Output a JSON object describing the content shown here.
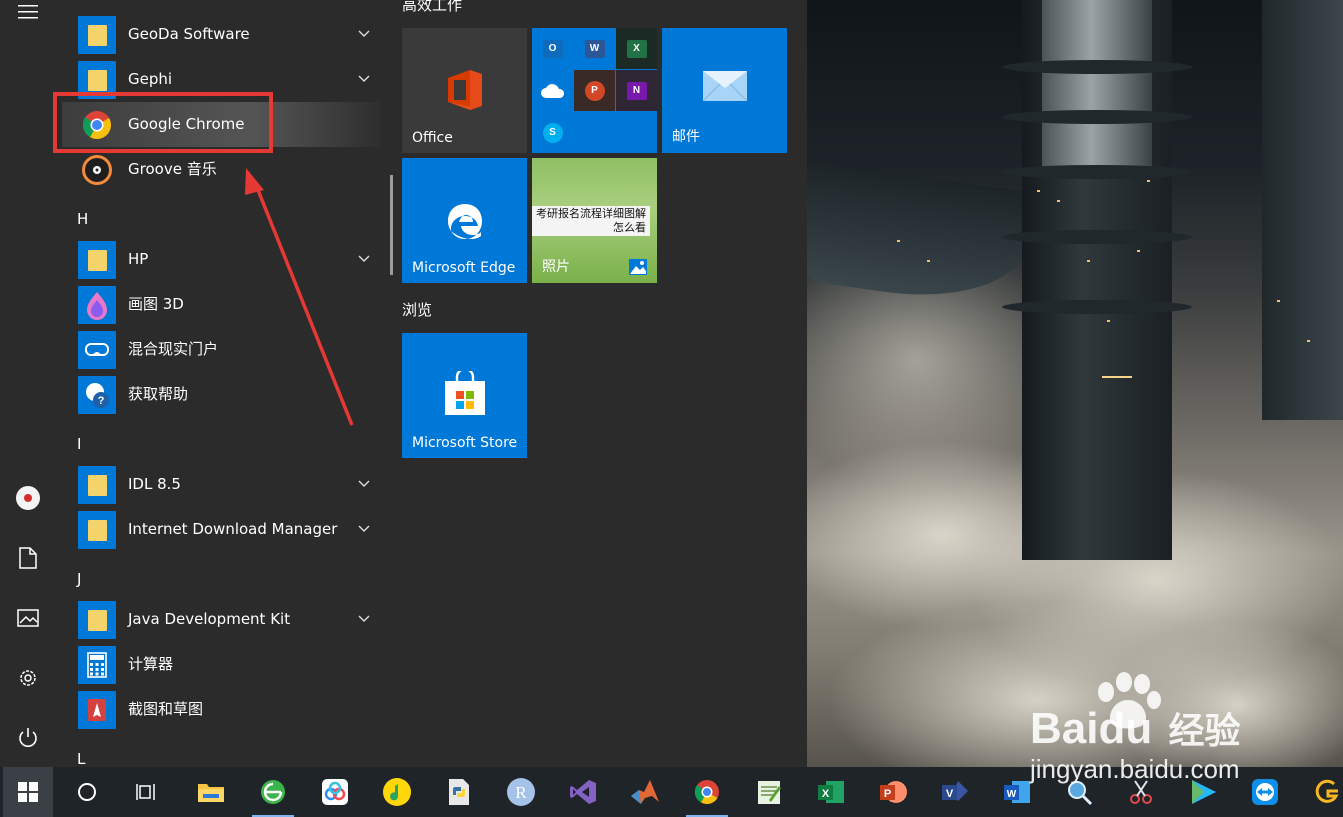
{
  "apps": {
    "geoda": "GeoDa Software",
    "gephi": "Gephi",
    "chrome": "Google Chrome",
    "groove": "Groove 音乐",
    "letter_h": "H",
    "hp": "HP",
    "paint3d": "画图 3D",
    "mixed_reality": "混合现实门户",
    "get_help": "获取帮助",
    "letter_i": "I",
    "idl": "IDL 8.5",
    "idm": "Internet Download Manager",
    "letter_j": "J",
    "jdk": "Java Development Kit",
    "calculator": "计算器",
    "snip": "截图和草图",
    "letter_l": "L"
  },
  "tiles": {
    "group_productivity": "高效工作",
    "office": "Office",
    "mail": "邮件",
    "edge": "Microsoft Edge",
    "photos": "照片",
    "photos_caption": "考研报名流程详细图解怎么看",
    "group_browse": "浏览",
    "store": "Microsoft Store"
  },
  "watermark": {
    "brand_a": "Bai",
    "brand_b": "du",
    "brand_c": "经验",
    "url": "jingyan.baidu.com"
  },
  "colors": {
    "accent": "#0078d7",
    "highlight_box": "#e53935",
    "menu_bg": "#2b2b2b",
    "taskbar_bg": "#1f2428"
  },
  "taskbar": {
    "items": [
      "windows-start",
      "cortana",
      "task-view",
      "file-explorer",
      "360-browser",
      "baidu-netdisk",
      "qq-music",
      "python",
      "r",
      "visual-studio",
      "matlab",
      "google-chrome",
      "notepad",
      "excel",
      "powerpoint",
      "visio",
      "word",
      "search-tool",
      "snipping",
      "video-player",
      "teamviewer",
      "other"
    ]
  }
}
